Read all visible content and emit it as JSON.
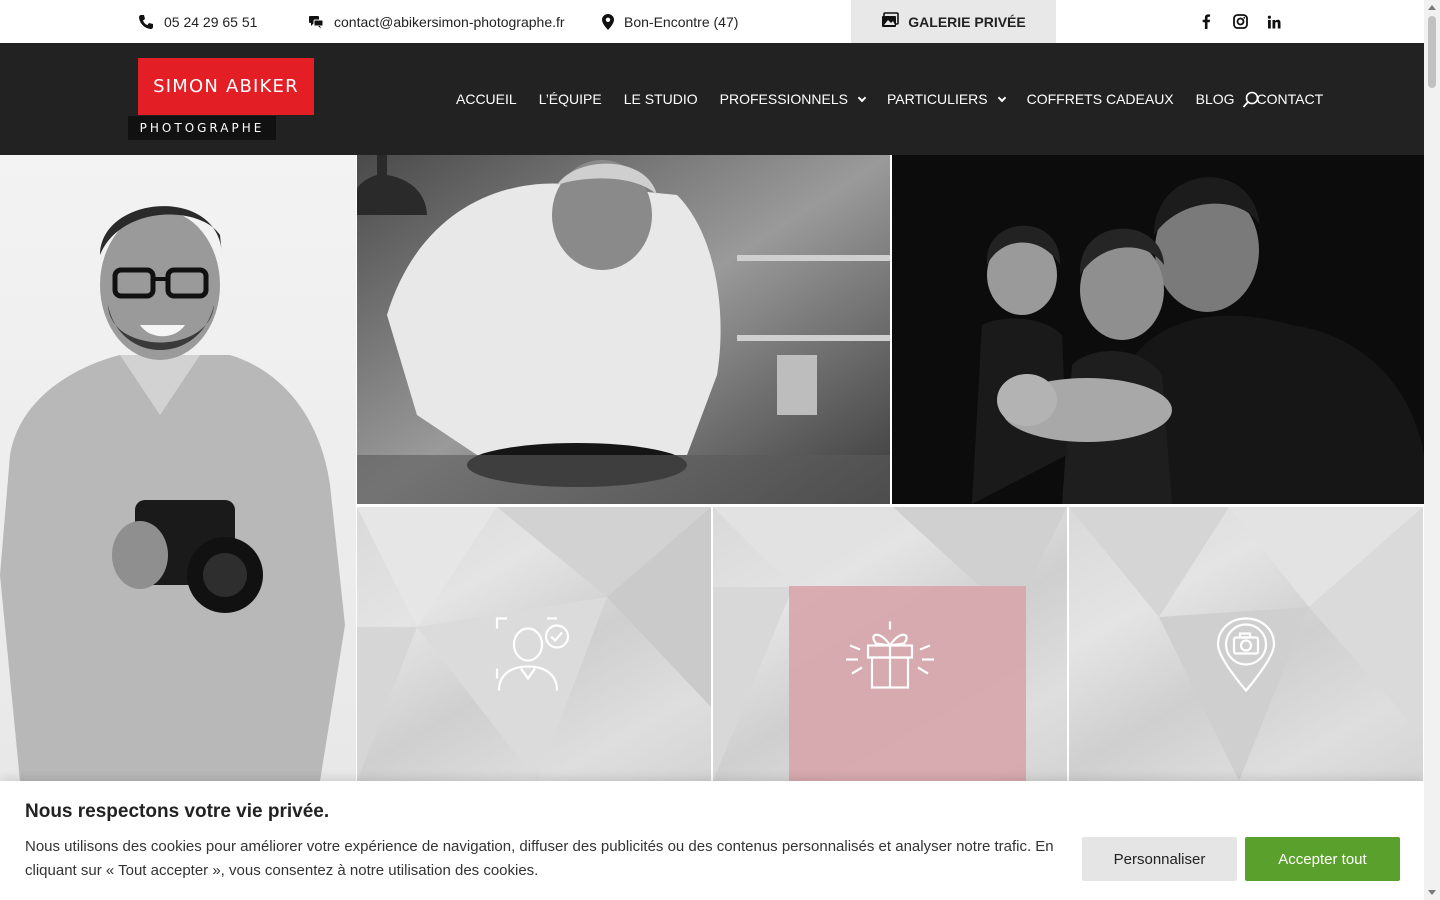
{
  "topbar": {
    "phone": "05 24 29 65 51",
    "email": "contact@abikersimon-photographe.fr",
    "location": "Bon-Encontre (47)",
    "gallery_label": "GALERIE PRIVÉE",
    "socials": [
      "facebook-icon",
      "instagram-icon",
      "linkedin-icon"
    ]
  },
  "logo": {
    "name": "SIMON ABIKER",
    "subtitle": "PHOTOGRAPHE",
    "brand_color": "#e31e24"
  },
  "nav": {
    "items": [
      {
        "label": "ACCUEIL",
        "dropdown": false
      },
      {
        "label": "L’ÉQUIPE",
        "dropdown": false
      },
      {
        "label": "LE STUDIO",
        "dropdown": false
      },
      {
        "label": "PROFESSIONNELS",
        "dropdown": true
      },
      {
        "label": "PARTICULIERS",
        "dropdown": true
      },
      {
        "label": "COFFRETS CADEAUX",
        "dropdown": false
      },
      {
        "label": "BLOG",
        "dropdown": false
      },
      {
        "label": "CONTACT",
        "dropdown": false
      }
    ],
    "search_icon": "search-icon",
    "background": "#222222"
  },
  "tiles": [
    {
      "icon": "portrait-check-icon"
    },
    {
      "icon": "gift-icon"
    },
    {
      "icon": "camera-pin-icon"
    }
  ],
  "cookie": {
    "title": "Nous respectons votre vie privée.",
    "text": "Nous utilisons des cookies pour améliorer votre expérience de navigation, diffuser des publicités ou des contenus personnalisés et analyser notre trafic. En cliquant sur « Tout accepter », vous consentez à notre utilisation des cookies.",
    "customize_label": "Personnaliser",
    "accept_label": "Accepter tout",
    "accept_color": "#5aa02c"
  }
}
